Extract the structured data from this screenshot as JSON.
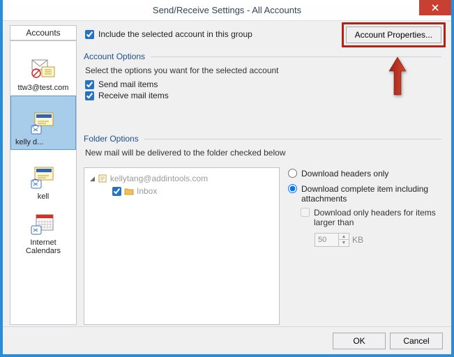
{
  "title": "Send/Receive Settings - All Accounts",
  "sidebar": {
    "header": "Accounts",
    "items": [
      {
        "label": "ttw3@test.com"
      },
      {
        "label": "kelly              d..."
      },
      {
        "label": "kell"
      },
      {
        "label": "Internet Calendars"
      }
    ]
  },
  "include": {
    "label": "Include the selected account in this group",
    "btn": "Account Properties..."
  },
  "account_options": {
    "header": "Account Options",
    "help": "Select the options you want for the selected account",
    "send": "Send mail items",
    "receive": "Receive mail items"
  },
  "folder_options": {
    "header": "Folder Options",
    "help": "New mail will be delivered to the folder checked below",
    "account_email": "kellytang@addintools.com",
    "inbox": "Inbox"
  },
  "download": {
    "headers_only": "Download headers only",
    "complete": "Download complete item including attachments",
    "large_only": "Download only headers for items larger than",
    "size": "50",
    "unit": "KB"
  },
  "buttons": {
    "ok": "OK",
    "cancel": "Cancel"
  }
}
